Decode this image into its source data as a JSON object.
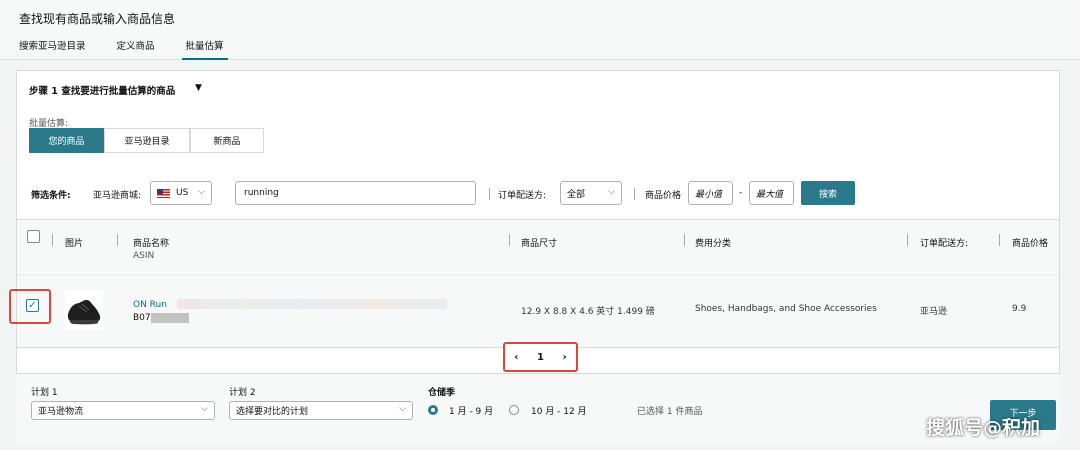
{
  "header": {
    "title": "查找现有商品或输入商品信息",
    "tabs": [
      {
        "label": "搜索亚马逊目录",
        "active": false
      },
      {
        "label": "定义商品",
        "active": false
      },
      {
        "label": "批量估算",
        "active": true
      }
    ]
  },
  "step": {
    "title": "步骤 1 查找要进行批量估算的商品",
    "caret": "▼"
  },
  "batch": {
    "label": "批量估算:",
    "segments": [
      {
        "label": "您的商品",
        "active": true
      },
      {
        "label": "亚马逊目录",
        "active": false
      },
      {
        "label": "新商品",
        "active": false
      }
    ]
  },
  "filters": {
    "label": "筛选条件:",
    "marketplace_label": "亚马逊商城:",
    "marketplace_value": "US",
    "search_value": "running",
    "fulfillment_label": "订单配送方:",
    "fulfillment_value": "全部",
    "price_label": "商品价格",
    "min_placeholder": "最小值",
    "dash": "-",
    "max_placeholder": "最大值",
    "search_button": "搜索"
  },
  "table": {
    "headers": {
      "image": "图片",
      "name": "商品名称",
      "asin": "ASIN",
      "dimensions": "商品尺寸",
      "fee_category": "费用分类",
      "fulfillment": "订单配送方:",
      "price": "商品价格"
    },
    "rows": [
      {
        "checked": true,
        "name": "ON Run",
        "asin": "B07",
        "dimensions": "12.9 X 8.8 X 4.6 英寸 1.499 磅",
        "fee_category": "Shoes, Handbags, and Shoe Accessories",
        "fulfillment": "亚马逊",
        "price": "9.9"
      }
    ]
  },
  "pagination": {
    "prev": "‹",
    "page": "1",
    "next": "›"
  },
  "footer": {
    "plan1_label": "计划 1",
    "plan1_value": "亚马逊物流",
    "plan2_label": "计划 2",
    "plan2_value": "选择要对比的计划",
    "season_label": "仓储季",
    "season_options": [
      {
        "label": "1 月 - 9 月",
        "selected": true
      },
      {
        "label": "10 月 - 12 月",
        "selected": false
      }
    ],
    "selected_count": "已选择 1 件商品",
    "next_button": "下一步"
  },
  "watermark": "搜狐号@积加",
  "colors": {
    "accent": "#2b7a8c",
    "link": "#007185",
    "highlight": "#d9493b"
  }
}
